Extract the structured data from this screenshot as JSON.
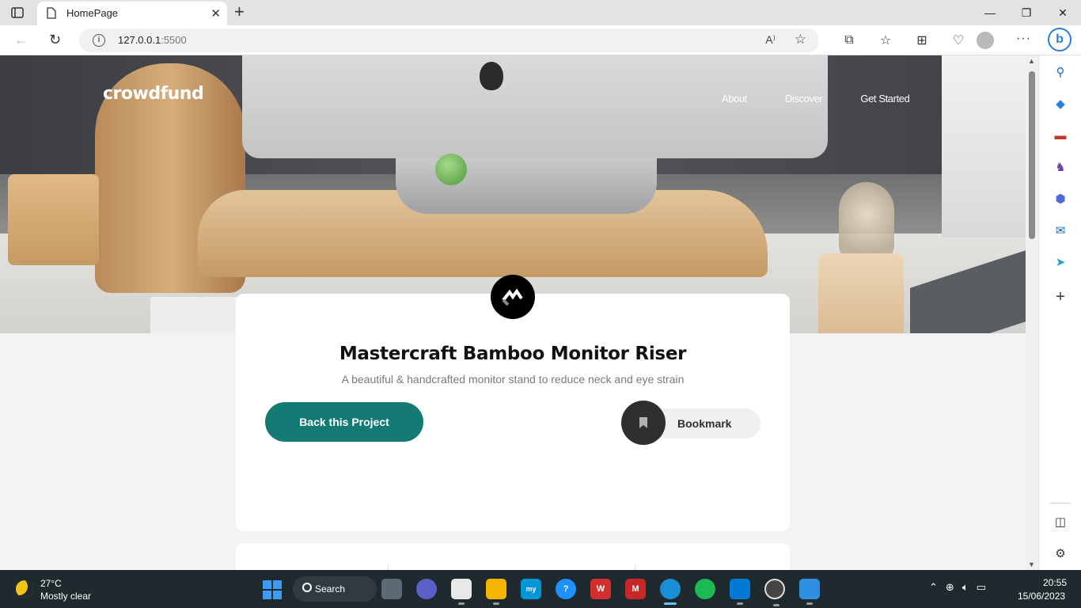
{
  "browser": {
    "tab_title": "HomePage",
    "url_host": "127.0.0.1",
    "url_port": ":5500"
  },
  "site": {
    "brand": "crowdfund",
    "nav": [
      "About",
      "Discover",
      "Get Started"
    ]
  },
  "project": {
    "title": "Mastercraft Bamboo Monitor Riser",
    "subtitle": "A beautiful & handcrafted monitor stand to reduce neck and eye strain",
    "back_button": "Back this Project",
    "bookmark_label": "Bookmark"
  },
  "colors": {
    "accent": "#147b74",
    "dark": "#2f2f2f"
  },
  "taskbar": {
    "temperature": "27°C",
    "weather": "Mostly clear",
    "search": "Search",
    "time": "20:55",
    "date": "15/06/2023"
  }
}
